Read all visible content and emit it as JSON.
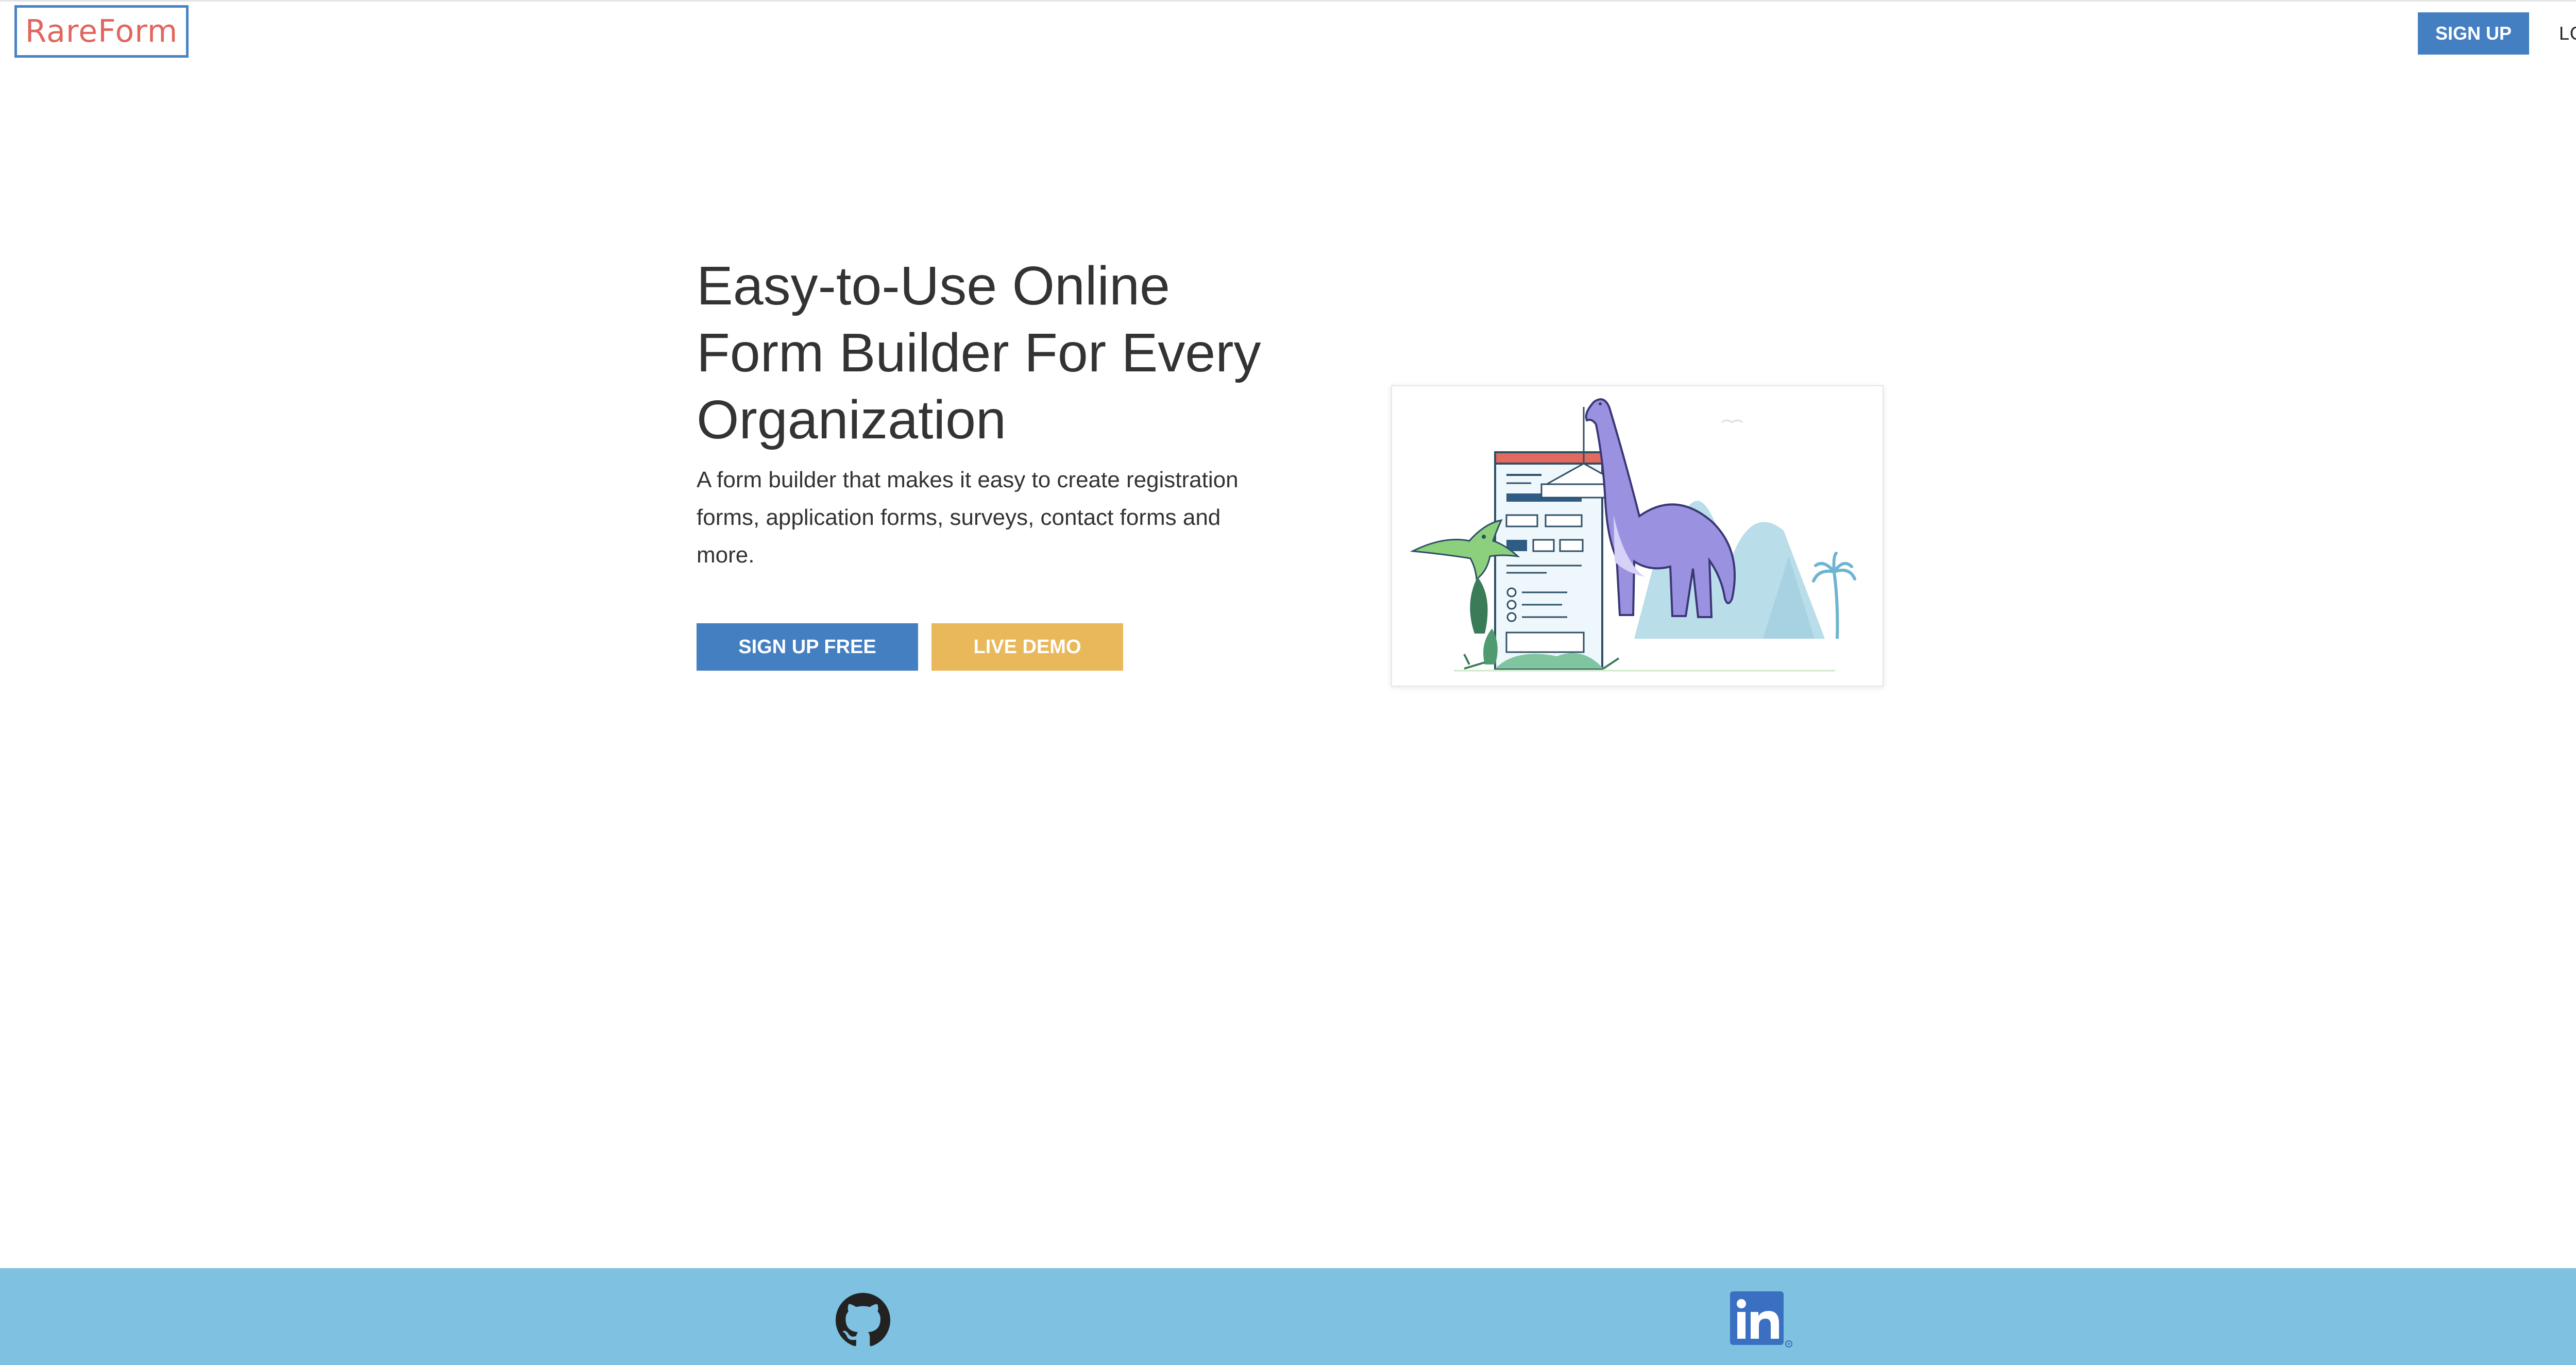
{
  "header": {
    "logo_text": "RareForm",
    "nav": {
      "signup_label": "SIGN UP",
      "login_label": "LOGIN"
    }
  },
  "hero": {
    "title": "Easy-to-Use Online Form Builder For Every Organization",
    "subtitle": "A form builder that makes it easy to create registration forms, application forms, surveys, contact forms and more.",
    "primary_cta": "SIGN UP FREE",
    "secondary_cta": "LIVE DEMO"
  },
  "illustration": {
    "description_icon": "dinosaur-form-illustration"
  },
  "footer": {
    "icons": [
      "github-icon",
      "linkedin-icon"
    ]
  },
  "colors": {
    "brand_blue": "#437fc1",
    "logo_red": "#e0665f",
    "demo_yellow": "#e9b85a",
    "footer_blue": "#7ec1e0",
    "text_dark": "#333333"
  }
}
